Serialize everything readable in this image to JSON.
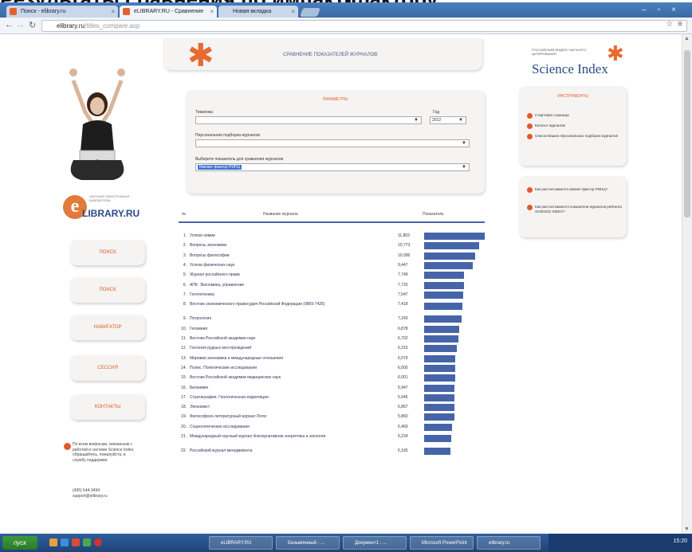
{
  "caption": "Результаты сравнения по импакт-фактору",
  "browser": {
    "tabs": [
      {
        "label": "Поиск - elibrary.ru"
      },
      {
        "label": "eLIBRARY.RU - Сравнение"
      },
      {
        "label": "Новая вкладка"
      }
    ],
    "url_host": "elibrary.ru",
    "url_path": "/titles_compare.asp"
  },
  "left": {
    "logo_text": "LIBRARY.RU",
    "logo_letter": "e",
    "logo_small": "НАУЧНАЯ ЭЛЕКТРОННАЯ БИБЛИОТЕКА",
    "menu": [
      "ПОИСК",
      "ПОИСК",
      "НАВИГАТОР",
      "СЕССИЯ",
      "КОНТАКТЫ"
    ],
    "help_text": "По всем вопросам, связанным с работой в системе Science Index, обращайтесь, пожалуйста, в службу поддержки:",
    "help_contact": "(495) 544-3494 support@elibrary.ru"
  },
  "header": {
    "title": "СРАВНЕНИЕ ПОКАЗАТЕЛЕЙ ЖУРНАЛОВ"
  },
  "params": {
    "heading": "ПАРАМЕТРЫ",
    "topic_label": "Тематика",
    "topic_value": "",
    "year_label": "Год",
    "year_value": "2012",
    "selection_label": "Персональная подборка журналов",
    "selection_value": "",
    "indicator_label": "Выберите показатель для сравнения журналов",
    "indicator_value": "Импакт-фактор РИНЦ"
  },
  "table": {
    "col_num": "№",
    "col_name": "Название журнала",
    "col_value": "Показатель",
    "rows": [
      {
        "n": "1.",
        "name": "Успехи химии",
        "value": "11,803",
        "v": 11.803
      },
      {
        "n": "2.",
        "name": "Вопросы экономики",
        "value": "10,773",
        "v": 10.773
      },
      {
        "n": "3.",
        "name": "Вопросы философии",
        "value": "10,000",
        "v": 10.0
      },
      {
        "n": "4.",
        "name": "Успехи физических наук",
        "value": "9,447",
        "v": 9.447
      },
      {
        "n": "5.",
        "name": "Журнал российского права",
        "value": "7,749",
        "v": 7.749
      },
      {
        "n": "6.",
        "name": "АПК: Экономика, управление",
        "value": "7,725",
        "v": 7.725
      },
      {
        "n": "7.",
        "name": "Геотектоника",
        "value": "7,547",
        "v": 7.547
      },
      {
        "n": "8.",
        "name": "Вестник экономического правосудия Российской Федерации (0869-7426)",
        "value": "7,418",
        "v": 7.418
      },
      {
        "n": "9.",
        "name": "Петрология",
        "value": "7,243",
        "v": 7.243
      },
      {
        "n": "10.",
        "name": "Геохимия",
        "value": "6,878",
        "v": 6.878
      },
      {
        "n": "11.",
        "name": "Вестник Российской академии наук",
        "value": "6,702",
        "v": 6.702
      },
      {
        "n": "12.",
        "name": "Геология рудных месторождений",
        "value": "6,315",
        "v": 6.315
      },
      {
        "n": "13.",
        "name": "Мировая экономика и международные отношения",
        "value": "6,079",
        "v": 6.079
      },
      {
        "n": "14.",
        "name": "Полис. Политические исследования",
        "value": "6,000",
        "v": 6.0
      },
      {
        "n": "15.",
        "name": "Вестник Российской академии медицинских наук",
        "value": "6,001",
        "v": 6.001
      },
      {
        "n": "16.",
        "name": "Биохимия",
        "value": "5,947",
        "v": 5.947
      },
      {
        "n": "17.",
        "name": "Стратиграфия. Геологическая корреляция",
        "value": "5,945",
        "v": 5.945
      },
      {
        "n": "18.",
        "name": "Экономист",
        "value": "5,867",
        "v": 5.867
      },
      {
        "n": "19.",
        "name": "Философско-литературный журнал Логос",
        "value": "5,860",
        "v": 5.86
      },
      {
        "n": "20.",
        "name": "Социологические исследования",
        "value": "5,469",
        "v": 5.469
      },
      {
        "n": "21.",
        "name": "Международный научный журнал Альтернативная энергетика и экология",
        "value": "5,224",
        "v": 5.224
      },
      {
        "n": "22.",
        "name": "Российский журнал менеджмента",
        "value": "5,165",
        "v": 5.165
      }
    ]
  },
  "right": {
    "si_small": "РОССИЙСКИЙ ИНДЕКС НАУЧНОГО ЦИТИРОВАНИЯ",
    "si_big": "Science Index",
    "tools_heading": "ИНСТРУМЕНТЫ",
    "tools": [
      "Стартовая страница",
      "Каталог журналов",
      "Список Ваших персональных подборок журналов"
    ],
    "info": [
      "Как рассчитывается импакт-фактор РИНЦ?",
      "Как рассчитываются показатели журналов рейтинга SCIENCE INDEX?"
    ]
  },
  "taskbar": {
    "start": "пуск",
    "items": [
      "eLIBRARY.RU",
      "Безымянный - ...",
      "Документ1 - ...",
      "Microsoft PowerPoint",
      "elibrary.ru"
    ],
    "clock": "15:20"
  },
  "colors": {
    "accent": "#e05a2b",
    "bar": "#4664a8",
    "brand": "#2a4a83"
  }
}
